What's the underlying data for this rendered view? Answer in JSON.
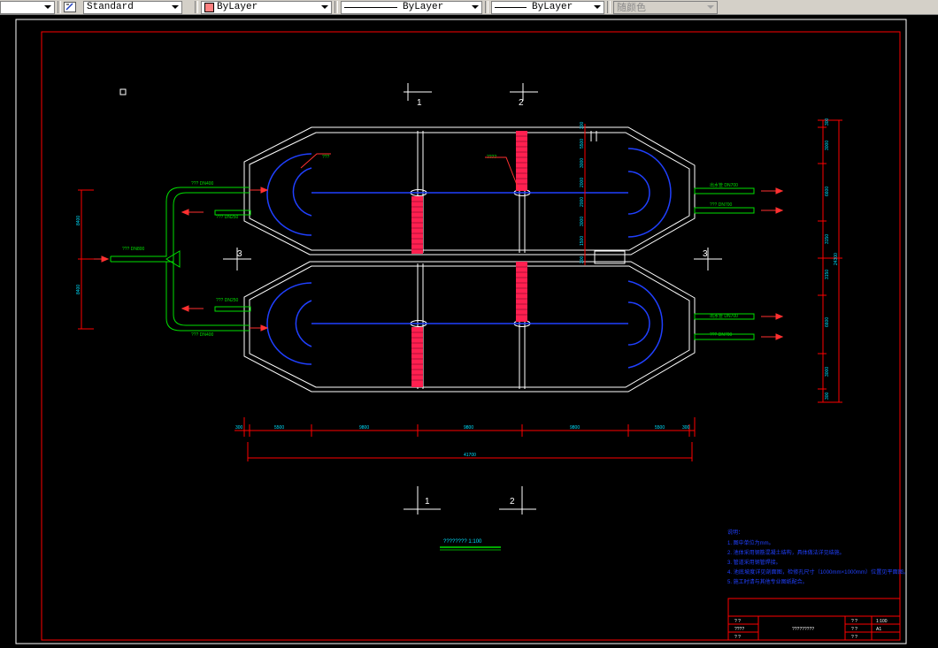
{
  "toolbar": {
    "textstyle": "Standard",
    "layer_color": "ByLayer",
    "linetype": "ByLayer",
    "lineweight": "ByLayer",
    "plotstyle": "随颜色"
  },
  "section_markers": {
    "top_1": "1",
    "top_2": "2",
    "left_3": "3",
    "right_3": "3",
    "bottom_1": "1",
    "bottom_2": "2"
  },
  "pipes": {
    "in_main": "???  DN800",
    "upper_in": "???  DN400",
    "upper_return": "???  DN250",
    "lower_return": "???  DN250",
    "lower_in": "???  DN400",
    "out1": "出水管  DN700",
    "out2": "???  DN700",
    "out3": "出水管  DN700",
    "out4": "???  DN700",
    "leader_a": "???",
    "leader_b": "????"
  },
  "dims_bottom": {
    "d1": "300",
    "d2": "5500",
    "d3": "9800",
    "d4": "9800",
    "d5": "9800",
    "d6": "5500",
    "d7": "300",
    "total": "41700"
  },
  "dims_left": {
    "a": "8400",
    "b": "8400"
  },
  "dims_right": {
    "r1": "300",
    "r2": "3000",
    "r3": "6600",
    "r4": "3150",
    "r5": "3150",
    "r6": "6600",
    "r7": "3000",
    "r8": "300",
    "total": "24300"
  },
  "dims_mid": {
    "m1": "300",
    "m2": "5500",
    "m3": "3000",
    "m4": "2000",
    "m5": "2000",
    "m6": "3000",
    "m7": "1500",
    "m8": "300"
  },
  "plan_title": "????????   1:100",
  "notes": {
    "heading": "说明：",
    "items": [
      "1. 图中单位为mm。",
      "2. 池体采用钢筋混凝土结构，具体做法详见结施。",
      "3. 管道采用钢管焊接。",
      "4. 池底坡度详见剖面图，检修孔尺寸（1000mm×1000mm）位置见平面图。",
      "5. 施工时请与其他专业图纸配合。"
    ]
  },
  "titleblock": {
    "r1c1": "?  ?",
    "r2c1": "????",
    "r3c1": "?  ?",
    "center": "?????????",
    "r1c3": "?  ?",
    "r1c4": "1:100",
    "r2c3": "?  ?",
    "r2c4": "A1",
    "r3c3": "?  ?"
  }
}
